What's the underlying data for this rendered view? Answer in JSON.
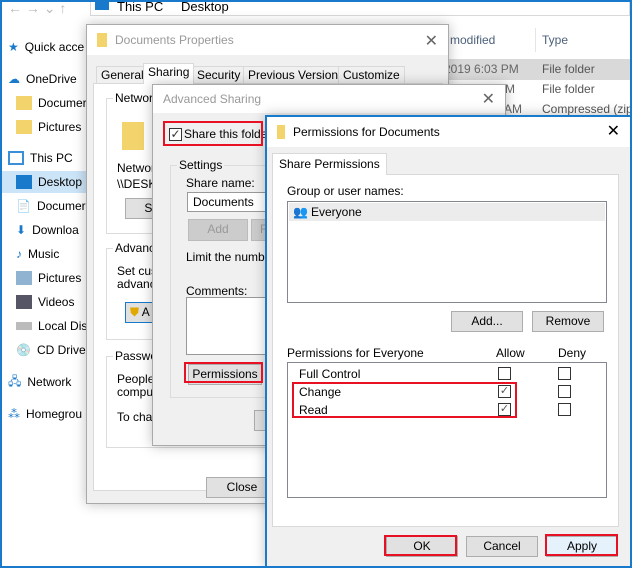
{
  "explorer": {
    "breadcrumb": [
      "This PC",
      "Desktop"
    ],
    "nav": [
      "Quick acce",
      "OneDrive",
      "Documer",
      "Pictures",
      "This PC",
      "Desktop",
      "Documer",
      "Downloa",
      "Music",
      "Pictures",
      "Videos",
      "Local Disl",
      "CD Drive",
      "Network",
      "Homegrou"
    ],
    "columns": {
      "modified": "modified",
      "type": "Type"
    },
    "rows": [
      {
        "modified": "2019 6:03 PM",
        "type": "File folder"
      },
      {
        "modified": "M",
        "type": "File folder"
      },
      {
        "modified": "AM",
        "type": "Compressed (zip"
      }
    ]
  },
  "properties": {
    "title": "Documents Properties",
    "tabs": [
      "General",
      "Sharing",
      "Security",
      "Previous Versions",
      "Customize"
    ],
    "network_group": "Network",
    "network_label": "Network",
    "network_path": "\\\\DESK",
    "share_button": "Sha",
    "advanced_group": "Advance",
    "advanced_text1": "Set cust",
    "advanced_text2": "advanc",
    "advanced_button": "A",
    "password_group": "Passwor",
    "password_text1": "People",
    "password_text2": "compute",
    "password_text3": "To char",
    "close": "Close"
  },
  "advanced": {
    "title": "Advanced Sharing",
    "share_checkbox": "Share this folder",
    "share_checked": true,
    "settings": "Settings",
    "share_name_label": "Share name:",
    "share_name_value": "Documents",
    "add": "Add",
    "remove_partial": "R",
    "limit": "Limit the number",
    "comments": "Comments:",
    "permissions": "Permissions"
  },
  "permissions": {
    "title": "Permissions for Documents",
    "tab": "Share Permissions",
    "group_label": "Group or user names:",
    "users": [
      "Everyone"
    ],
    "add": "Add...",
    "remove": "Remove",
    "perm_label": "Permissions for Everyone",
    "allow": "Allow",
    "deny": "Deny",
    "rows": [
      {
        "name": "Full Control",
        "allow": false,
        "deny": false
      },
      {
        "name": "Change",
        "allow": true,
        "deny": false
      },
      {
        "name": "Read",
        "allow": true,
        "deny": false
      }
    ],
    "ok": "OK",
    "cancel": "Cancel",
    "apply": "Apply"
  },
  "colors": {
    "highlight": "#e81123",
    "accent": "#1979ca"
  }
}
